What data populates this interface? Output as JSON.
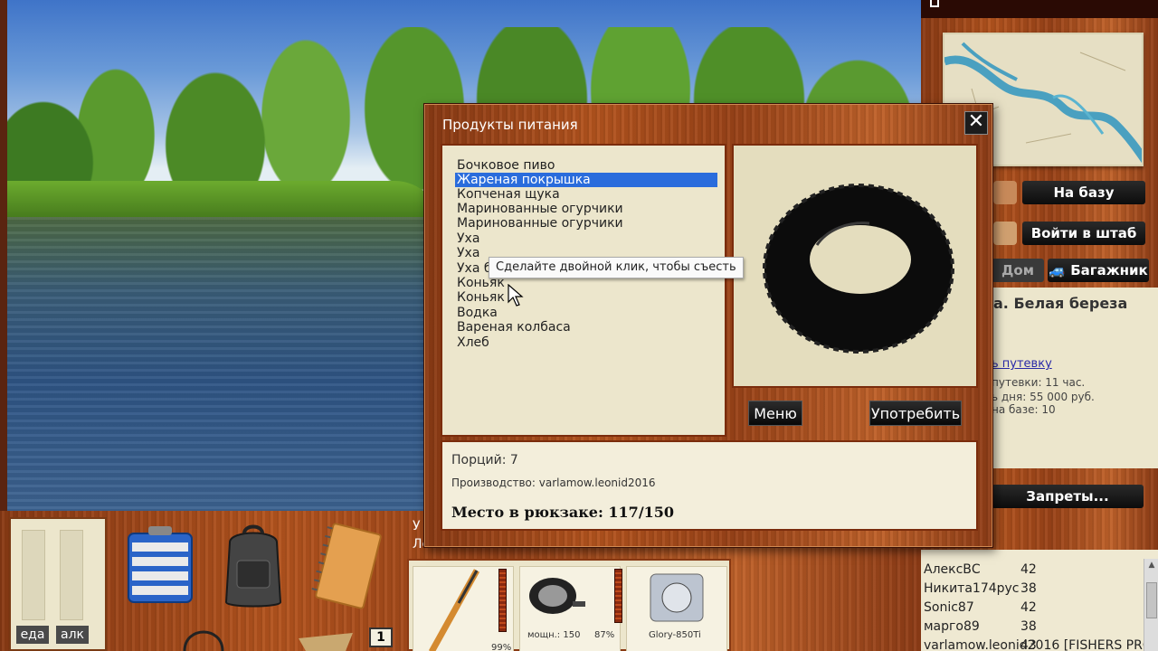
{
  "dialog": {
    "title": "Продукты питания",
    "close_glyph": "✕",
    "items": [
      "Бочковое пиво",
      "Жареная покрышка",
      "Копченая щука",
      "Маринованные огурчики",
      "Маринованные огурчики",
      "Уха",
      "Уха",
      "Уха б",
      "Коньяк",
      "Коньяк",
      "Водка",
      "Вареная колбаса",
      "Хлеб"
    ],
    "selected_index": 1,
    "tooltip": "Сделайте двойной клик, чтобы съесть",
    "menu_button": "Меню",
    "use_button": "Употребить",
    "portions": "Порций: 7",
    "producer": "Производство: varlamow.leonid2016",
    "backpack_space": "Место в рюкзаке: 117/150",
    "preview_item_icon": "tire-icon"
  },
  "right_panel": {
    "to_base_button": "На базу",
    "hq_button": "Войти в штаб",
    "home_tab": "Дом",
    "trunk_button": "Багажник",
    "location_title": "а. Белая береза",
    "buy_pass_link": "ь путевку",
    "info_lines": [
      "путевки: 11 час.",
      "ь дня: 55 000 руб.",
      "на базе: 10"
    ],
    "bans_button": "Запреты...",
    "players": [
      {
        "name": "АлексВС",
        "score": "42"
      },
      {
        "name": "Никита174рус",
        "score": "38"
      },
      {
        "name": "Sonic87",
        "score": "42"
      },
      {
        "name": "марго89",
        "score": "38"
      },
      {
        "name": "varlamow.leonid2016 [FISHERS PRO]",
        "score": "43"
      }
    ]
  },
  "bottom": {
    "food_label": "еда",
    "alc_label": "алк",
    "badge": "1",
    "partial_label_1": "У",
    "partial_label_2": "Леска",
    "reel_power": "мощн.: 150",
    "reel_percent": "87%",
    "line_name": "Glory-850Ti",
    "rod_percent": "99%"
  },
  "colors": {
    "selection": "#2a6cdc",
    "pane_bg": "#ece6cc",
    "wood": "#b4541e",
    "button_dark": "#0c0c0c"
  }
}
